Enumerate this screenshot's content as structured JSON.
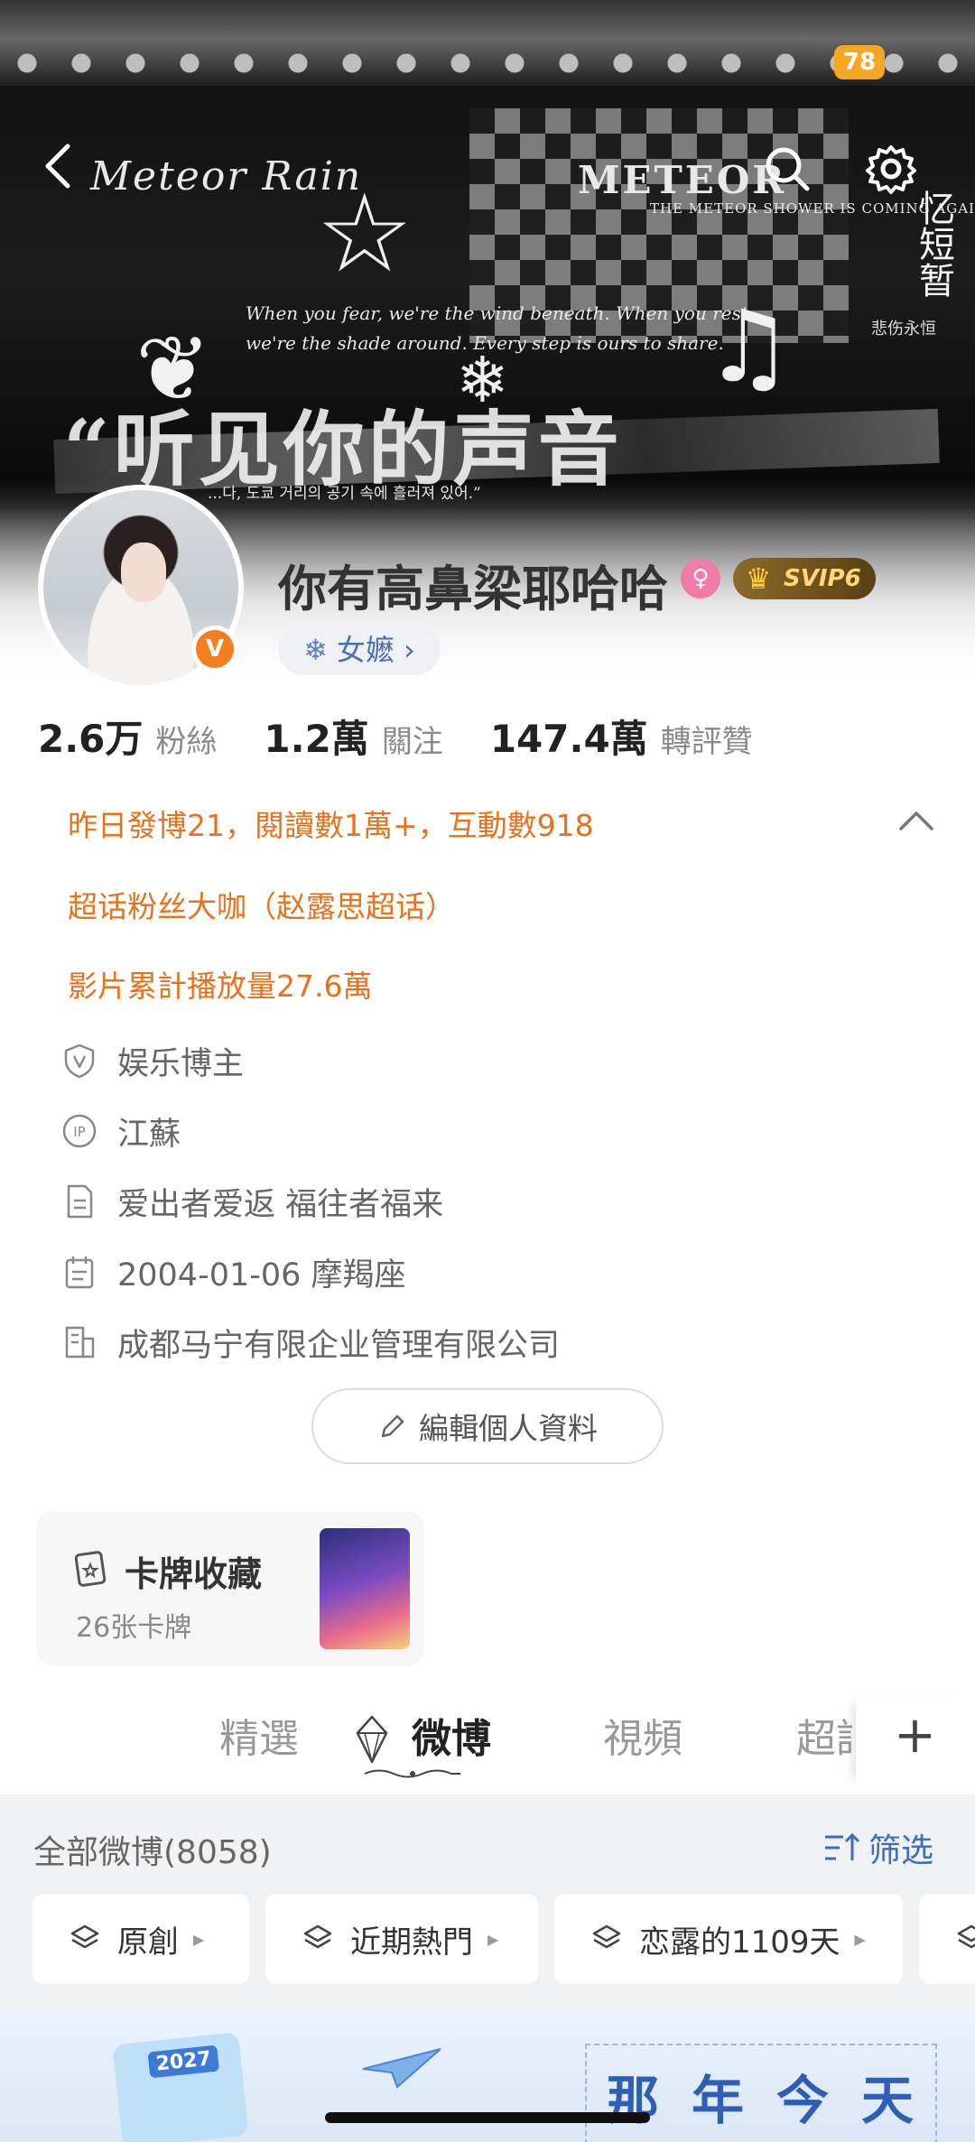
{
  "status_bar": {
    "battery": "78"
  },
  "banner": {
    "deco_title": "Meteor Rain",
    "deco_meteor": "METEOR",
    "deco_sub": "THE METEOR SHOWER IS COMING AGAIN",
    "deco_line1": "When you fear, we're the wind beneath. When you rest,",
    "deco_line2": "we're the shade around. Every step is ours to share.",
    "deco_big": "“听见你的声音",
    "deco_korean": "...다, 도쿄 거리의 공기 속에 흘러져 있어.”",
    "deco_vertical": "忆短暂",
    "deco_vertical_sub": "悲伤永恒"
  },
  "profile": {
    "nickname": "你有高鼻梁耶哈哈",
    "gender_symbol": "♀",
    "svip_label": "SVIP6",
    "tag_label": "女嬷 ›",
    "verified_mark": "V"
  },
  "stats": [
    {
      "num": "2.6万",
      "label": "粉絲"
    },
    {
      "num": "1.2萬",
      "label": "關注"
    },
    {
      "num": "147.4萬",
      "label": "轉評贊"
    }
  ],
  "highlights": {
    "line1": "昨日發博21，閱讀數1萬+，互動數918",
    "line2": "超话粉丝大咖（赵露思超话）",
    "line3": "影片累計播放量27.6萬"
  },
  "info": {
    "category": "娱乐博主",
    "ip_location": "江蘇",
    "bio": "爱出者爱返 福往者福来",
    "birthday": "2004-01-06 摩羯座",
    "company": "成都马宁有限企业管理有限公司"
  },
  "edit_button_label": "編輯個人資料",
  "card_collection": {
    "title": "卡牌收藏",
    "count": "26张卡牌"
  },
  "tabs": {
    "items": [
      "精選",
      "微博",
      "視頻",
      "超話"
    ],
    "active": "微博",
    "add_symbol": "+"
  },
  "feed_filter": {
    "all_label": "全部微博(8058)",
    "filter_label": "筛选",
    "pills": [
      "原創",
      "近期熱門",
      "恋露的1109天"
    ]
  },
  "bottom_banner": {
    "calendar_year": "2027",
    "text": "那年今天"
  },
  "colors": {
    "accent_orange": "#e8721c",
    "link_blue": "#3a6ec0",
    "verified_orange": "#f57e1f"
  }
}
